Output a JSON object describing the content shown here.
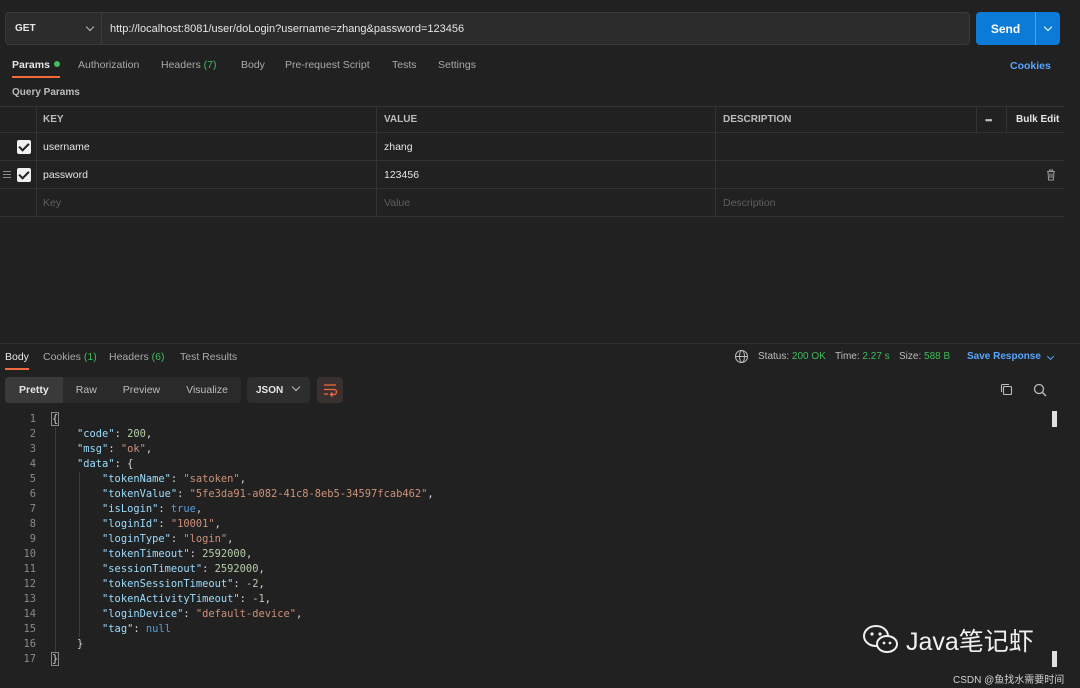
{
  "request": {
    "method": "GET",
    "url": "http://localhost:8081/user/doLogin?username=zhang&password=123456",
    "send_label": "Send"
  },
  "request_tabs": {
    "params": "Params",
    "authorization": "Authorization",
    "headers": "Headers",
    "headers_count": "(7)",
    "body": "Body",
    "prerequest": "Pre-request Script",
    "tests": "Tests",
    "settings": "Settings",
    "cookies": "Cookies"
  },
  "query_params": {
    "title": "Query Params",
    "columns": {
      "key": "KEY",
      "value": "VALUE",
      "description": "DESCRIPTION",
      "bulk_edit": "Bulk Edit",
      "more": "•••"
    },
    "rows": [
      {
        "key": "username",
        "value": "zhang",
        "description": "",
        "checked": true
      },
      {
        "key": "password",
        "value": "123456",
        "description": "",
        "checked": true
      }
    ],
    "placeholders": {
      "key": "Key",
      "value": "Value",
      "description": "Description"
    }
  },
  "response_tabs": {
    "body": "Body",
    "cookies": "Cookies",
    "cookies_count": "(1)",
    "headers": "Headers",
    "headers_count": "(6)",
    "test_results": "Test Results"
  },
  "response_status": {
    "status_label": "Status:",
    "status_value": "200 OK",
    "time_label": "Time:",
    "time_value": "2.27 s",
    "size_label": "Size:",
    "size_value": "588 B",
    "save_response": "Save Response"
  },
  "view_modes": [
    "Pretty",
    "Raw",
    "Preview",
    "Visualize"
  ],
  "format": "JSON",
  "code_lines": [
    [
      [
        "p",
        "{"
      ]
    ],
    [
      [
        "k",
        "    \"code\""
      ],
      [
        "p",
        ": "
      ],
      [
        "n",
        "200"
      ],
      [
        "p",
        ","
      ]
    ],
    [
      [
        "k",
        "    \"msg\""
      ],
      [
        "p",
        ": "
      ],
      [
        "s",
        "\"ok\""
      ],
      [
        "p",
        ","
      ]
    ],
    [
      [
        "k",
        "    \"data\""
      ],
      [
        "p",
        ": {"
      ]
    ],
    [
      [
        "k",
        "        \"tokenName\""
      ],
      [
        "p",
        ": "
      ],
      [
        "s",
        "\"satoken\""
      ],
      [
        "p",
        ","
      ]
    ],
    [
      [
        "k",
        "        \"tokenValue\""
      ],
      [
        "p",
        ": "
      ],
      [
        "s",
        "\"5fe3da91-a082-41c8-8eb5-34597fcab462\""
      ],
      [
        "p",
        ","
      ]
    ],
    [
      [
        "k",
        "        \"isLogin\""
      ],
      [
        "p",
        ": "
      ],
      [
        "b",
        "true"
      ],
      [
        "p",
        ","
      ]
    ],
    [
      [
        "k",
        "        \"loginId\""
      ],
      [
        "p",
        ": "
      ],
      [
        "s",
        "\"10001\""
      ],
      [
        "p",
        ","
      ]
    ],
    [
      [
        "k",
        "        \"loginType\""
      ],
      [
        "p",
        ": "
      ],
      [
        "s",
        "\"login\""
      ],
      [
        "p",
        ","
      ]
    ],
    [
      [
        "k",
        "        \"tokenTimeout\""
      ],
      [
        "p",
        ": "
      ],
      [
        "n",
        "2592000"
      ],
      [
        "p",
        ","
      ]
    ],
    [
      [
        "k",
        "        \"sessionTimeout\""
      ],
      [
        "p",
        ": "
      ],
      [
        "n",
        "2592000"
      ],
      [
        "p",
        ","
      ]
    ],
    [
      [
        "k",
        "        \"tokenSessionTimeout\""
      ],
      [
        "p",
        ": "
      ],
      [
        "n",
        "-2"
      ],
      [
        "p",
        ","
      ]
    ],
    [
      [
        "k",
        "        \"tokenActivityTimeout\""
      ],
      [
        "p",
        ": "
      ],
      [
        "n",
        "-1"
      ],
      [
        "p",
        ","
      ]
    ],
    [
      [
        "k",
        "        \"loginDevice\""
      ],
      [
        "p",
        ": "
      ],
      [
        "s",
        "\"default-device\""
      ],
      [
        "p",
        ","
      ]
    ],
    [
      [
        "k",
        "        \"tag\""
      ],
      [
        "p",
        ": "
      ],
      [
        "b",
        "null"
      ]
    ],
    [
      [
        "p",
        "    }"
      ]
    ],
    [
      [
        "p",
        "}"
      ]
    ]
  ],
  "watermark": {
    "brand": "Java笔记虾",
    "source": "CSDN @鱼找水需要时间"
  },
  "colors": {
    "accent_orange": "#f26b3a",
    "send_blue": "#0c7bd8",
    "link_blue": "#58a6ff",
    "status_green": "#3fbd5a"
  }
}
